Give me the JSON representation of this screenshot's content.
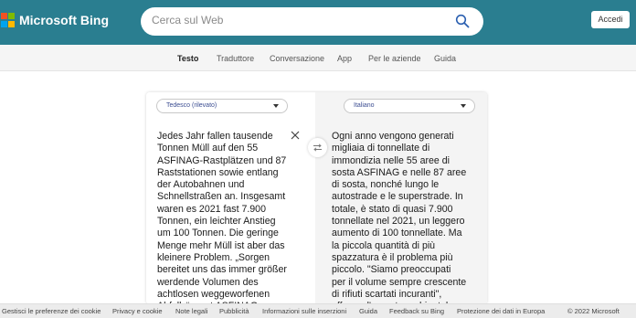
{
  "brand": {
    "name": "Microsoft Bing",
    "squares": [
      "#f25022",
      "#7fba00",
      "#00a4ef",
      "#ffb900"
    ]
  },
  "search": {
    "placeholder": "Cerca sul Web",
    "icon": "search-icon"
  },
  "header": {
    "signin_label": "Accedi",
    "background": "#2a7e90"
  },
  "tabs": [
    {
      "label": "Testo",
      "active": true
    },
    {
      "label": "Traduttore"
    },
    {
      "label": "Conversazione"
    },
    {
      "label": "App"
    },
    {
      "label": "Per le aziende"
    },
    {
      "label": "Guida"
    }
  ],
  "translator": {
    "source_lang": "Tedesco (rilevato)",
    "target_lang": "Italiano",
    "source_lines": [
      "Jedes Jahr fallen tausende",
      "Tonnen Müll auf den 55",
      "ASFINAG-Rastplätzen und 87",
      "Raststationen sowie entlang",
      "der Autobahnen und",
      "Schnellstraßen an. Insgesamt",
      "waren es 2021 fast 7.900",
      "Tonnen, ein leichter Anstieg",
      "um 100 Tonnen. Die geringe",
      "Menge mehr Müll ist aber das",
      "kleinere Problem. „Sorgen",
      "bereitet uns das immer größer",
      "werdende Volumen des",
      "achtlosen weggeworfenen",
      "Abfalls“, sagt ASFINAG-"
    ],
    "target_lines": [
      "Ogni anno vengono generati",
      "migliaia di tonnellate di",
      "immondizia nelle 55 aree di",
      "sosta ASFINAG e nelle 87 aree",
      "di sosta, nonché lungo le",
      "autostrade e le superstrade. In",
      "totale, è stato di quasi 7.900",
      "tonnellate nel 2021, un leggero",
      "aumento di 100 tonnellate. Ma",
      "la piccola quantità di più",
      "spazzatura è il problema più",
      "piccolo. \"Siamo preoccupati",
      "per il volume sempre crescente",
      "di rifiuti scartati incuranti\",",
      "afferma l'esperto ambientale"
    ]
  },
  "footer": {
    "links": [
      "Gestisci le preferenze dei cookie",
      "Privacy e cookie",
      "Note legali",
      "Pubblicità",
      "Informazioni sulle inserzioni",
      "Guida",
      "Feedback su Bing",
      "Protezione dei dati in Europa"
    ],
    "copyright": "© 2022 Microsoft"
  }
}
